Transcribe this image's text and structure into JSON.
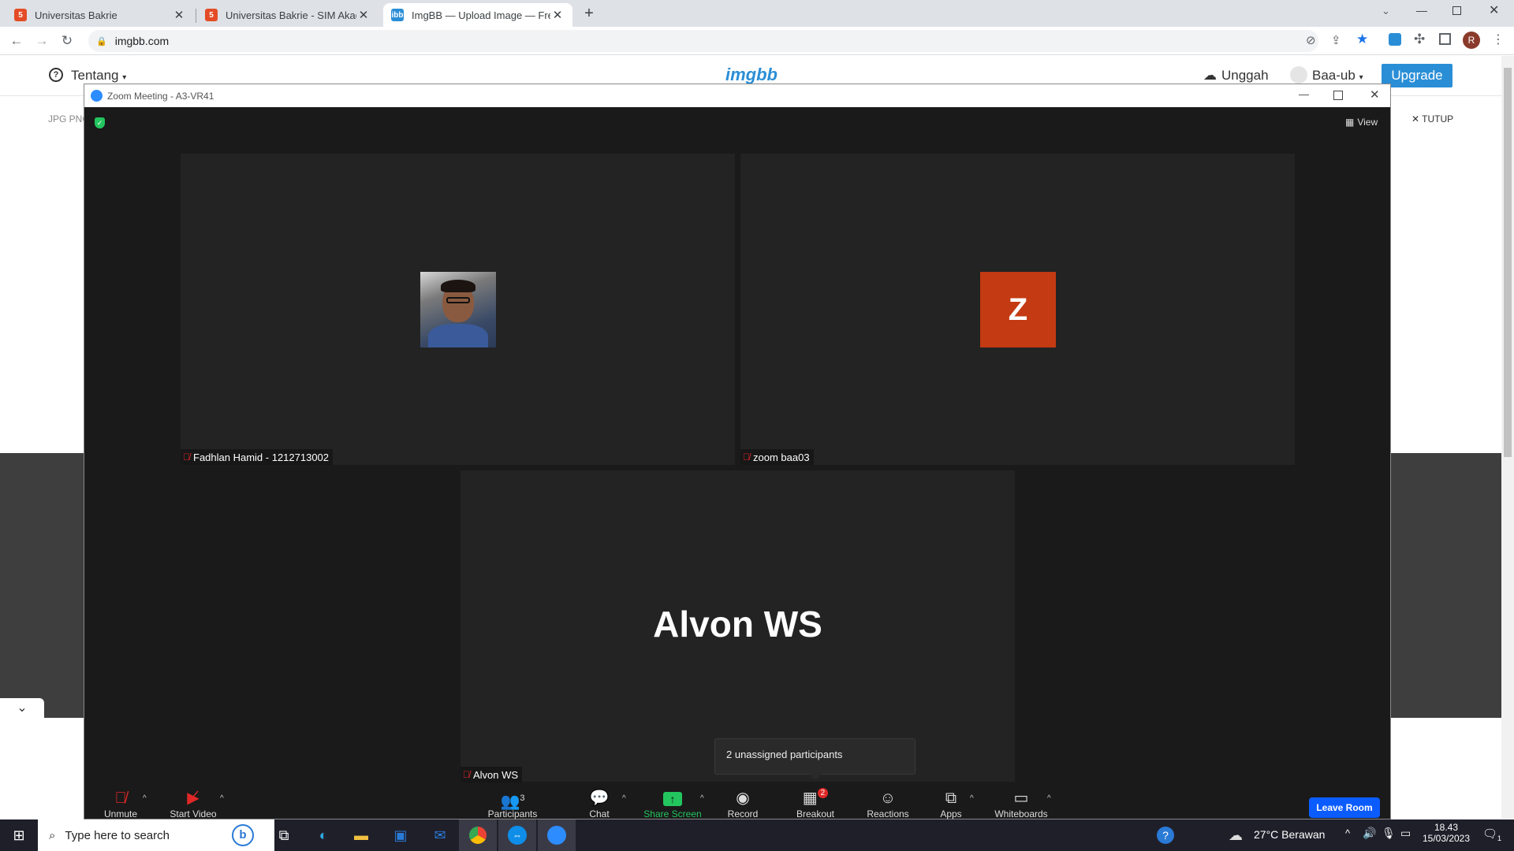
{
  "browser": {
    "tabs": [
      {
        "title": "Universitas Bakrie",
        "active": false
      },
      {
        "title": "Universitas Bakrie - SIM Akadem",
        "active": false
      },
      {
        "title": "ImgBB — Upload Image — Free I",
        "active": true
      }
    ],
    "new_tab": "+",
    "url": "imgbb.com",
    "profile_initial": "R"
  },
  "imgbb": {
    "about": "Tentang",
    "logo": "imgbb",
    "upload": "Unggah",
    "user": "Baa-ub",
    "upgrade": "Upgrade",
    "formats": "JPG PNG",
    "close": "TUTUP"
  },
  "zoom": {
    "window_title": "Zoom Meeting - A3-VR41",
    "view": "View",
    "participants": [
      {
        "name": "Fadhlan Hamid - 1212713002"
      },
      {
        "name": "zoom baa03",
        "initial": "Z",
        "color": "#c43a12"
      },
      {
        "name": "Alvon WS",
        "display": "Alvon WS"
      }
    ],
    "tooltip": "2 unassigned participants",
    "controls": {
      "unmute": "Unmute",
      "start_video": "Start Video",
      "participants": "Participants",
      "participants_count": "3",
      "chat": "Chat",
      "share_screen": "Share Screen",
      "record": "Record",
      "breakout_rooms": "Breakout Rooms",
      "breakout_badge": "2",
      "reactions": "Reactions",
      "apps": "Apps",
      "whiteboards": "Whiteboards",
      "leave": "Leave Room"
    },
    "colors": {
      "leave": "#0b5cff",
      "share": "#23c55e"
    }
  },
  "taskbar": {
    "search_placeholder": "Type here to search",
    "weather": "27°C  Berawan",
    "time": "18.43",
    "date": "15/03/2023",
    "notification_count": "1"
  }
}
